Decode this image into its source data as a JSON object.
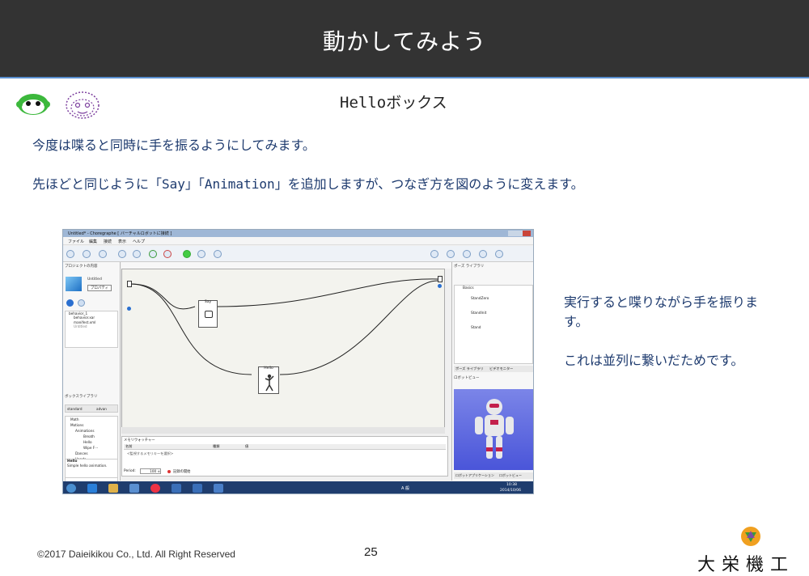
{
  "header": {
    "title": "動かしてみよう"
  },
  "subtitle": "Helloボックス",
  "paragraphs": [
    "今度は喋ると同時に手を振るようにしてみます。",
    "先ほどと同じように「Say」「Animation」を追加しますが、つなぎ方を図のように変えます。"
  ],
  "side_note": [
    "実行すると喋りながら手を振ります。",
    "これは並列に繋いだためです。"
  ],
  "footer": {
    "copyright": "©2017 Daieikikou Co., Ltd. All Right Reserved",
    "page_number": "25",
    "company": "大栄機工"
  },
  "screenshot": {
    "window_title": "Untitled* - Choregraphe [ バーチャルロボットに接続 ]",
    "menu": [
      "ファイル",
      "編集",
      "接続",
      "表示",
      "ヘルプ"
    ],
    "left_panel": {
      "project_title": "プロジェクトの内容",
      "project_name": "Untitled",
      "properties_button": "プロパティ",
      "tree": [
        "behavior_1",
        "behavior.xar",
        "manifest.xml",
        "Untitled"
      ],
      "library_title": "ボックスライブラリ",
      "library_tabs": [
        "standard",
        "advan"
      ],
      "library_items": [
        "Math",
        "Motions",
        "Animations",
        "Breath",
        "Hello",
        "Wipe F···",
        "Dances",
        "Hands"
      ],
      "description_title": "Hello",
      "description_text": "Simple hello animation."
    },
    "boxes": {
      "say": "Say",
      "hello": "Hello"
    },
    "memory": {
      "title": "メモリウォッチャー",
      "cols": [
        "名前",
        "種類",
        "値"
      ],
      "hint": "<監視するメモリキーを選択>",
      "period_label": "Period:",
      "period_value": "100 ≑",
      "record_label": "記録の開始"
    },
    "right_panel": {
      "pose_title": "ポーズ ライブラリ",
      "poses": [
        "Basics",
        "StandZero",
        "StandInit",
        "Stand"
      ],
      "tabs": [
        "ポーズ ライブラリ",
        "ビデオモニター"
      ],
      "robot_view_title": "ロボットビュー",
      "bottom_tabs": [
        "ロボットアプリケーション",
        "ロボットビュー"
      ]
    },
    "taskbar": {
      "time": "10:38",
      "date": "2014/10/06",
      "lang": "A 般"
    }
  }
}
